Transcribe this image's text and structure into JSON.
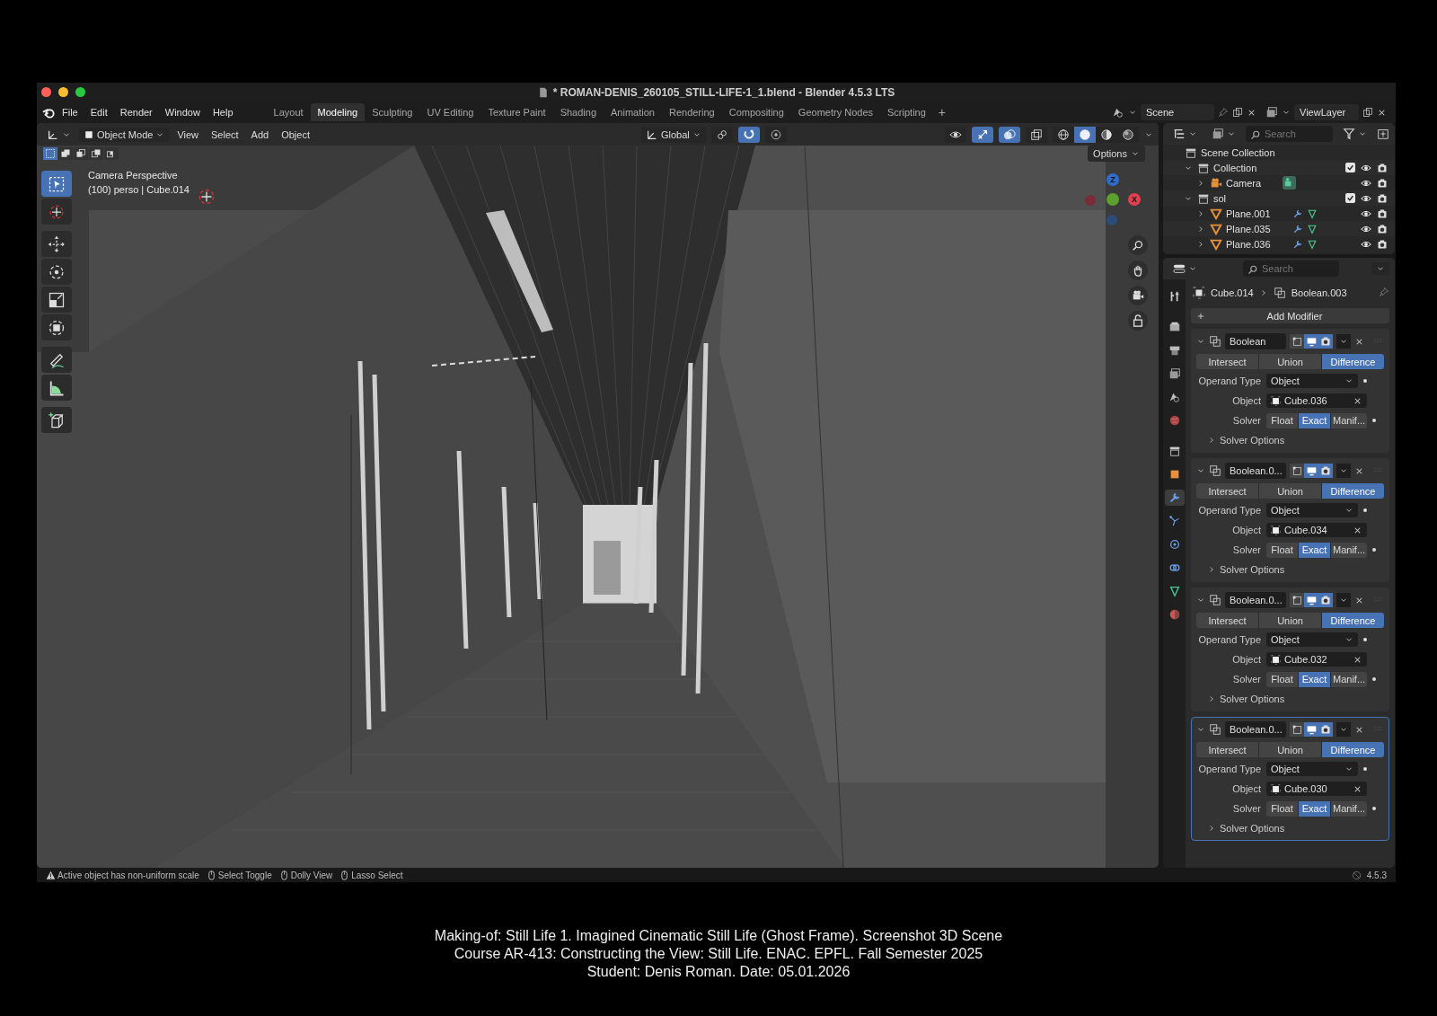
{
  "window": {
    "title": "* ROMAN-DENIS_260105_STILL-LIFE-1_1.blend - Blender 4.5.3 LTS"
  },
  "menu": [
    "File",
    "Edit",
    "Render",
    "Window",
    "Help"
  ],
  "workspaces": [
    {
      "label": "Layout",
      "selected": false
    },
    {
      "label": "Modeling",
      "selected": true
    },
    {
      "label": "Sculpting",
      "selected": false
    },
    {
      "label": "UV Editing",
      "selected": false
    },
    {
      "label": "Texture Paint",
      "selected": false
    },
    {
      "label": "Shading",
      "selected": false
    },
    {
      "label": "Animation",
      "selected": false
    },
    {
      "label": "Rendering",
      "selected": false
    },
    {
      "label": "Compositing",
      "selected": false
    },
    {
      "label": "Geometry Nodes",
      "selected": false
    },
    {
      "label": "Scripting",
      "selected": false
    }
  ],
  "add_workspace": "+",
  "scene": "Scene",
  "view_layer": "ViewLayer",
  "viewport": {
    "mode": "Object Mode",
    "menus": [
      "View",
      "Select",
      "Add",
      "Object"
    ],
    "orientation": "Global",
    "center_toggles": [
      {
        "kind": "pivot",
        "on": false
      },
      {
        "kind": "snap",
        "on": true
      },
      {
        "kind": "proportional",
        "on": false
      }
    ],
    "header_toggles": [
      {
        "kind": "visibility",
        "on": false
      },
      {
        "kind": "gizmo",
        "on": true
      },
      {
        "kind": "overlay",
        "on": true
      },
      {
        "kind": "xray",
        "on": false
      }
    ],
    "shading": [
      {
        "kind": "wireframe",
        "selected": false
      },
      {
        "kind": "solid",
        "selected": true
      },
      {
        "kind": "material",
        "selected": false
      },
      {
        "kind": "rendered",
        "selected": false
      }
    ],
    "select_modes": [
      {
        "kind": "set",
        "selected": true
      },
      {
        "kind": "extend",
        "selected": false
      },
      {
        "kind": "subtract",
        "selected": false
      },
      {
        "kind": "invert",
        "selected": false
      },
      {
        "kind": "intersect",
        "selected": false
      }
    ],
    "options": "Options",
    "camera_label": "Camera Perspective",
    "object_label": "(100) perso | Cube.014",
    "tools": [
      {
        "kind": "select",
        "selected": true
      },
      {
        "kind": "cursor",
        "selected": false
      },
      {
        "kind": "move",
        "selected": false
      },
      {
        "kind": "rotate",
        "selected": false
      },
      {
        "kind": "scale",
        "selected": false
      },
      {
        "kind": "transform",
        "selected": false
      },
      {
        "kind": "annotate",
        "selected": false
      },
      {
        "kind": "measure",
        "selected": false
      },
      {
        "kind": "add-cube",
        "selected": false
      }
    ],
    "axes": [
      "Z",
      "X"
    ]
  },
  "outliner": {
    "search": {
      "placeholder": "Search"
    },
    "tree": [
      {
        "label": "Scene Collection",
        "kind": "scene",
        "children": [
          {
            "label": "Collection",
            "kind": "collection",
            "expanded": true,
            "checked": true,
            "children": [
              {
                "label": "Camera",
                "kind": "camera",
                "expanded": false
              }
            ]
          },
          {
            "label": "sol",
            "kind": "collection",
            "expanded": true,
            "checked": true,
            "children": [
              {
                "label": "Plane.001",
                "kind": "mesh",
                "expanded": false
              },
              {
                "label": "Plane.035",
                "kind": "mesh",
                "expanded": false
              },
              {
                "label": "Plane.036",
                "kind": "mesh",
                "expanded": false
              }
            ]
          }
        ]
      }
    ]
  },
  "properties": {
    "search": {
      "placeholder": "Search"
    },
    "tabs": [
      {
        "kind": "tool",
        "selected": false
      },
      {
        "kind": "render",
        "selected": false
      },
      {
        "kind": "output",
        "selected": false
      },
      {
        "kind": "view-layer",
        "selected": false
      },
      {
        "kind": "scene",
        "selected": false
      },
      {
        "kind": "world",
        "selected": false
      },
      {
        "kind": "collection",
        "selected": false
      },
      {
        "kind": "object",
        "selected": false
      },
      {
        "kind": "modifiers",
        "selected": true
      },
      {
        "kind": "particles",
        "selected": false
      },
      {
        "kind": "physics",
        "selected": false
      },
      {
        "kind": "constraints",
        "selected": false
      },
      {
        "kind": "data",
        "selected": false
      },
      {
        "kind": "material",
        "selected": false
      }
    ],
    "breadcrumb": [
      "Cube.014",
      "Boolean.003"
    ],
    "add_modifier": "Add Modifier",
    "modifiers": [
      {
        "name": "Boolean",
        "active": false,
        "operations": [
          {
            "label": "Intersect",
            "selected": false
          },
          {
            "label": "Union",
            "selected": false
          },
          {
            "label": "Difference",
            "selected": true
          }
        ],
        "operand_label": "Operand Type",
        "operand_type": "Object",
        "object_label": "Object",
        "object": "Cube.036",
        "solver_label": "Solver",
        "solvers": [
          {
            "label": "Float",
            "selected": false
          },
          {
            "label": "Exact",
            "selected": true
          },
          {
            "label": "Manif...",
            "selected": false
          }
        ],
        "solver_options": "Solver Options"
      },
      {
        "name": "Boolean.0...",
        "active": false,
        "operations": [
          {
            "label": "Intersect",
            "selected": false
          },
          {
            "label": "Union",
            "selected": false
          },
          {
            "label": "Difference",
            "selected": true
          }
        ],
        "operand_label": "Operand Type",
        "operand_type": "Object",
        "object_label": "Object",
        "object": "Cube.034",
        "solver_label": "Solver",
        "solvers": [
          {
            "label": "Float",
            "selected": false
          },
          {
            "label": "Exact",
            "selected": true
          },
          {
            "label": "Manif...",
            "selected": false
          }
        ],
        "solver_options": "Solver Options"
      },
      {
        "name": "Boolean.0...",
        "active": false,
        "operations": [
          {
            "label": "Intersect",
            "selected": false
          },
          {
            "label": "Union",
            "selected": false
          },
          {
            "label": "Difference",
            "selected": true
          }
        ],
        "operand_label": "Operand Type",
        "operand_type": "Object",
        "object_label": "Object",
        "object": "Cube.032",
        "solver_label": "Solver",
        "solvers": [
          {
            "label": "Float",
            "selected": false
          },
          {
            "label": "Exact",
            "selected": true
          },
          {
            "label": "Manif...",
            "selected": false
          }
        ],
        "solver_options": "Solver Options"
      },
      {
        "name": "Boolean.0...",
        "active": true,
        "operations": [
          {
            "label": "Intersect",
            "selected": false
          },
          {
            "label": "Union",
            "selected": false
          },
          {
            "label": "Difference",
            "selected": true
          }
        ],
        "operand_label": "Operand Type",
        "operand_type": "Object",
        "object_label": "Object",
        "object": "Cube.030",
        "solver_label": "Solver",
        "solvers": [
          {
            "label": "Float",
            "selected": false
          },
          {
            "label": "Exact",
            "selected": true
          },
          {
            "label": "Manif...",
            "selected": false
          }
        ],
        "solver_options": "Solver Options"
      }
    ]
  },
  "status_bar": {
    "items": [
      {
        "kind": "warning",
        "text": "Active object has non-uniform scale"
      },
      {
        "kind": "mouse",
        "text": "Select Toggle"
      },
      {
        "kind": "mouse",
        "text": "Dolly View"
      },
      {
        "kind": "mouse",
        "text": "Lasso Select"
      }
    ],
    "version": "4.5.3"
  },
  "caption": [
    "Making-of: Still Life 1. Imagined Cinematic Still Life (Ghost Frame). Screenshot 3D Scene",
    "Course AR-413: Constructing the View: Still Life. ENAC. EPFL. Fall Semester 2025",
    "Student: Denis Roman. Date: 05.01.2026"
  ]
}
